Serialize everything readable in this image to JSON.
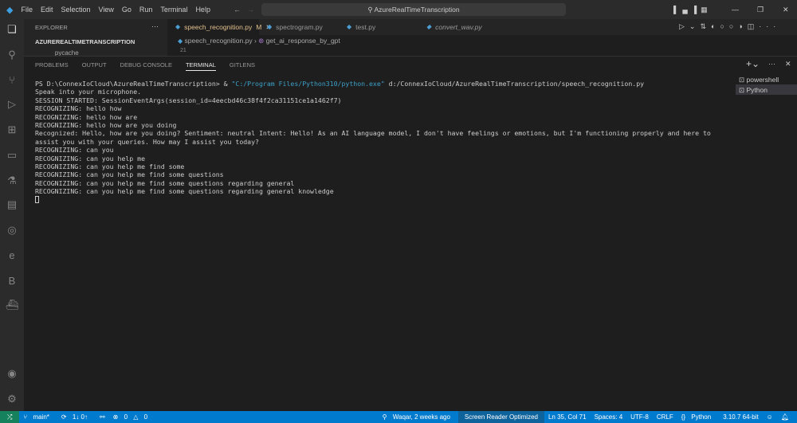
{
  "menu": [
    "File",
    "Edit",
    "Selection",
    "View",
    "Go",
    "Run",
    "Terminal",
    "Help"
  ],
  "search": "AzureRealTimeTranscription",
  "sidebar": {
    "title": "EXPLORER",
    "folder": "AZUREREALTIMETRANSCRIPTION",
    "item": "__pycache__"
  },
  "tabs": [
    {
      "label": "speech_recognition.py",
      "badge": "M"
    },
    {
      "label": "spectrogram.py"
    },
    {
      "label": "test.py"
    },
    {
      "label": "convert_wav.py"
    }
  ],
  "breadcrumb": {
    "file": "speech_recognition.py",
    "symbol": "get_ai_response_by_gpt"
  },
  "line_number": "21",
  "panel_tabs": [
    "PROBLEMS",
    "OUTPUT",
    "DEBUG CONSOLE",
    "TERMINAL",
    "GITLENS"
  ],
  "terminal": {
    "prompt": "PS D:\\ConnexIoCloud\\AzureRealTimeTranscription> & ",
    "exe": "\"C:/Program Files/Python310/python.exe\"",
    "script": " d:/ConnexIoCloud/AzureRealTimeTranscription/speech_recognition.py",
    "lines": [
      "Speak into your microphone.",
      "SESSION STARTED: SessionEventArgs(session_id=4eecbd46c38f4f2ca31151ce1a1462f7)",
      "RECOGNIZING: hello how",
      "RECOGNIZING: hello how are",
      "RECOGNIZING: hello how are you doing",
      "Recognized: Hello, how are you doing? Sentiment: neutral Intent: Hello! As an AI language model, I don't have feelings or emotions, but I'm functioning properly and here to assist you with your queries. How may I assist you today?",
      "RECOGNIZING: can you",
      "RECOGNIZING: can you help me",
      "RECOGNIZING: can you help me find some",
      "RECOGNIZING: can you help me find some questions",
      "RECOGNIZING: can you help me find some questions regarding general",
      "RECOGNIZING: can you help me find some questions regarding general knowledge"
    ]
  },
  "terminal_list": [
    "powershell",
    "Python"
  ],
  "status": {
    "branch": "main*",
    "sync": "1↓ 0↑",
    "errors": "0",
    "warnings": "0",
    "blame": "Waqar, 2 weeks ago",
    "reader": "Screen Reader Optimized",
    "position": "Ln 35, Col 71",
    "spaces": "Spaces: 4",
    "encoding": "UTF-8",
    "eol": "CRLF",
    "language": "Python",
    "interpreter": "3.10.7 64-bit"
  }
}
